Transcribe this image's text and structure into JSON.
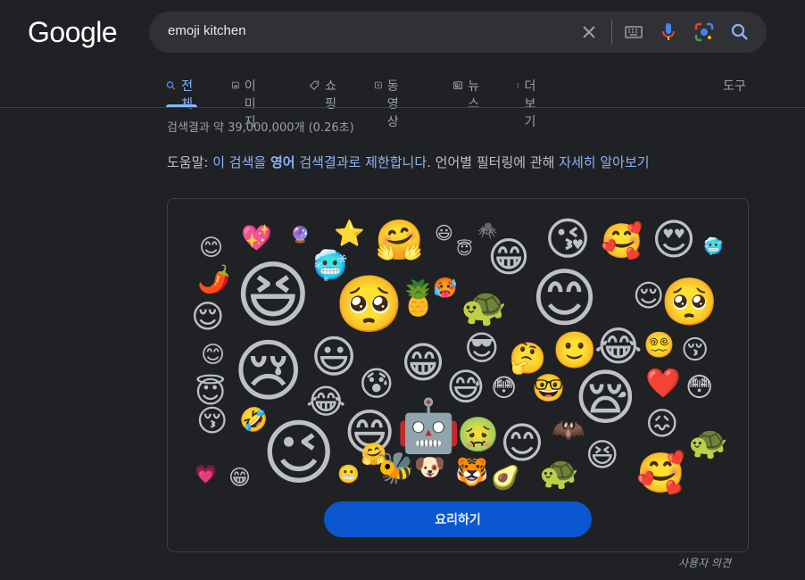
{
  "logo": "Google",
  "search": {
    "query": "emoji kitchen"
  },
  "tabs": [
    {
      "label": "전체",
      "icon": "search-icon",
      "active": true
    },
    {
      "label": "이미지",
      "icon": "image-icon",
      "active": false
    },
    {
      "label": "쇼핑",
      "icon": "tag-icon",
      "active": false
    },
    {
      "label": "동영상",
      "icon": "play-icon",
      "active": false
    },
    {
      "label": "뉴스",
      "icon": "news-icon",
      "active": false
    },
    {
      "label": "더보기",
      "icon": "more-vert-icon",
      "active": false
    }
  ],
  "tools_label": "도구",
  "result_stats": "검색결과 약 39,000,000개 (0.26초)",
  "helper": {
    "prefix": "도움말: ",
    "link1_a": "이 검색을 ",
    "link1_b": "영어",
    "mid": " 검색결과로 제한합니다",
    "after": ". 언어별 필터링에 관해 ",
    "link2": "자세히 알아보기"
  },
  "card": {
    "button_label": "요리하기",
    "emojis": [
      "😊",
      "💖",
      "🔮",
      "⭐",
      "🤗",
      "😃",
      "🕷️",
      "😇",
      "😁",
      "😘",
      "🥰",
      "😍",
      "🥶",
      "🌶️",
      "😆",
      "🥶",
      "🥺",
      "🍍",
      "🥵",
      "🐢",
      "😊",
      "😌",
      "🥺",
      "😌",
      "😊",
      "😢",
      "😃",
      "😁",
      "😎",
      "🤔",
      "🙂",
      "😂",
      "😵‍💫",
      "😚",
      "😇",
      "😂",
      "😰",
      "😅",
      "😳",
      "🤓",
      "😪",
      "❤️",
      "😳",
      "😚",
      "🤣",
      "😉",
      "😄",
      "🤖",
      "🤢",
      "😊",
      "🦇",
      "😆",
      "😖",
      "🐢",
      "💗",
      "😁",
      "🤗",
      "😬",
      "🐝",
      "🐶",
      "🐯",
      "🥑",
      "🐢",
      "🥰",
      "🤡",
      "🙂",
      "👀",
      "🥴",
      "☕"
    ]
  },
  "feedback": "사용자 의견"
}
